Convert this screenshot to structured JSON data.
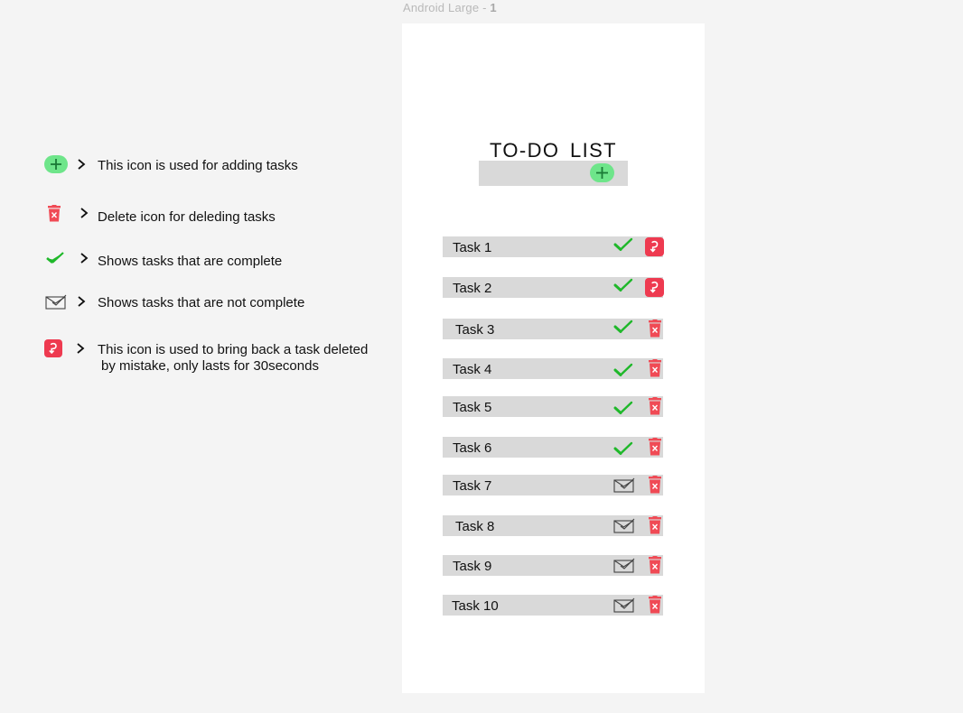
{
  "frame": {
    "name": "Android Large - ",
    "index": "1"
  },
  "app": {
    "title": "TO-DO  LIST",
    "add_icon": "plus-circle-icon",
    "tasks": [
      {
        "label": "Task 1",
        "status": "complete",
        "action": "undo"
      },
      {
        "label": "Task 2",
        "status": "complete",
        "action": "undo"
      },
      {
        "label": "Task 3",
        "status": "complete",
        "action": "delete"
      },
      {
        "label": "Task 4",
        "status": "complete",
        "action": "delete"
      },
      {
        "label": "Task 5",
        "status": "complete",
        "action": "delete"
      },
      {
        "label": "Task 6",
        "status": "complete",
        "action": "delete"
      },
      {
        "label": "Task 7",
        "status": "incomplete",
        "action": "delete"
      },
      {
        "label": "Task 8",
        "status": "incomplete",
        "action": "delete"
      },
      {
        "label": "Task 9",
        "status": "incomplete",
        "action": "delete"
      },
      {
        "label": "Task 10",
        "status": "incomplete",
        "action": "delete"
      }
    ]
  },
  "legend": [
    {
      "icon": "plus-circle-icon",
      "text": "This icon is used for adding tasks"
    },
    {
      "icon": "trash-icon",
      "text": "Delete icon for deleding tasks"
    },
    {
      "icon": "check-icon",
      "text": "Shows tasks that are complete"
    },
    {
      "icon": "envelope-check-icon",
      "text": "Shows tasks that are not complete"
    },
    {
      "icon": "undo-icon",
      "text": "This icon is used to bring back a task deleted",
      "text_line2": "by mistake, only lasts for 30seconds"
    }
  ],
  "colors": {
    "background": "#f4f4f4",
    "phone": "#ffffff",
    "bar": "#d9d9d9",
    "add_green": "#6ee58a",
    "check_green": "#1fb82a",
    "delete_red": "#f04a55",
    "undo_red": "#ee3a50"
  }
}
